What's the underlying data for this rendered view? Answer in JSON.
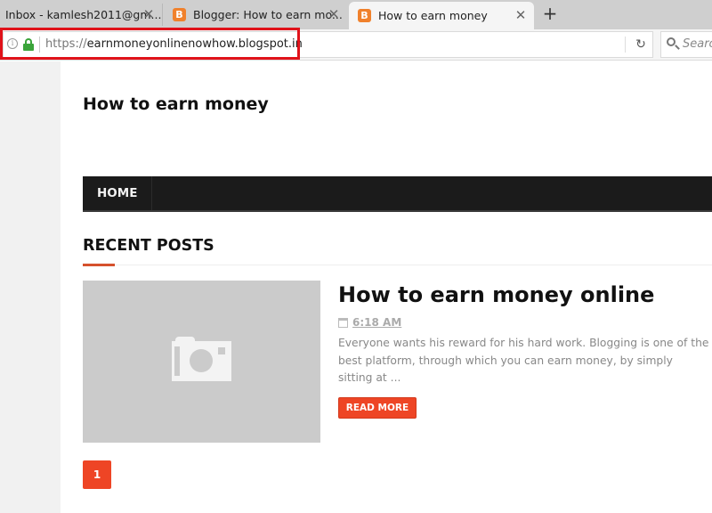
{
  "browser": {
    "tabs": [
      {
        "label": "Inbox - kamlesh2011@gm...",
        "active": false,
        "favicon": null
      },
      {
        "label": "Blogger: How to earn mo...",
        "active": false,
        "favicon": "blogger-icon"
      },
      {
        "label": "How to earn money",
        "active": true,
        "favicon": "blogger-icon"
      }
    ],
    "favicon_glyph": "B",
    "close_glyph": "✕",
    "new_tab_glyph": "+",
    "address": {
      "scheme": "https://",
      "host": "earnmoneyonlinenowhow.blogspot.in",
      "info_glyph": "i",
      "secure": true
    },
    "reload_glyph": "↻",
    "search_placeholder": "Search"
  },
  "colors": {
    "accent": "#ee4525",
    "highlight_box": "#e0121a",
    "menu_bg": "#1b1b1b",
    "lock": "#3aa43a",
    "favicon": "#f0812c"
  },
  "blog": {
    "title": "How to earn money",
    "menu": [
      {
        "label": "HOME"
      }
    ],
    "section_title": "RECENT POSTS",
    "posts": [
      {
        "title": "How to earn money online",
        "time": "6:18 AM",
        "snippet": "Everyone wants his reward for his hard work. Blogging is one of the best platform, through which you can earn money, by simply sitting at ...",
        "read_more": "READ MORE",
        "thumbnail": "camera-placeholder-icon"
      }
    ],
    "pagination": {
      "current": "1"
    }
  }
}
